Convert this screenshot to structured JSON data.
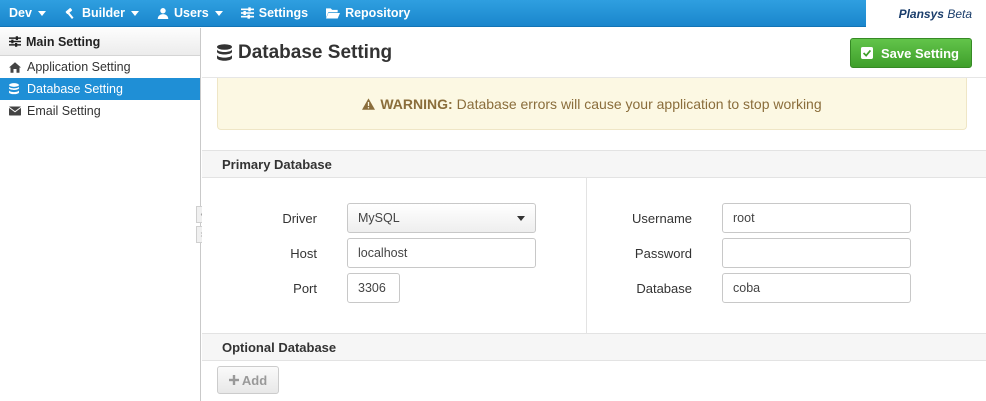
{
  "nav": {
    "items": [
      {
        "label": "Dev",
        "icon": "none",
        "has_caret": true
      },
      {
        "label": "Builder",
        "icon": "gavel-icon",
        "has_caret": true
      },
      {
        "label": "Users",
        "icon": "user-icon",
        "has_caret": true
      },
      {
        "label": "Settings",
        "icon": "sliders-icon",
        "has_caret": false
      },
      {
        "label": "Repository",
        "icon": "folder-open-icon",
        "has_caret": false
      }
    ],
    "brand_name": "Plansys",
    "brand_suffix": "Beta"
  },
  "sidebar": {
    "header": "Main Setting",
    "items": [
      {
        "label": "Application Setting",
        "icon": "home-icon",
        "active": false
      },
      {
        "label": "Database Setting",
        "icon": "database-icon",
        "active": true
      },
      {
        "label": "Email Setting",
        "icon": "envelope-icon",
        "active": false
      }
    ]
  },
  "main": {
    "title": "Database Setting",
    "save_label": "Save Setting",
    "warning_strong": "WARNING:",
    "warning_text": "Database errors will cause your application to stop working",
    "primary_section": "Primary Database",
    "optional_section": "Optional Database",
    "add_label": "Add",
    "fields": {
      "driver": {
        "label": "Driver",
        "value": "MySQL"
      },
      "host": {
        "label": "Host",
        "value": "localhost"
      },
      "port": {
        "label": "Port",
        "value": "3306"
      },
      "username": {
        "label": "Username",
        "value": "root"
      },
      "password": {
        "label": "Password",
        "value": ""
      },
      "database": {
        "label": "Database",
        "value": "coba"
      }
    }
  },
  "colors": {
    "nav_bg": "#1a86cc",
    "active_item": "#1f8fd6",
    "save_button": "#3f9f2b",
    "warning_bg": "#fcf8e3",
    "warning_text": "#8a6d3b"
  }
}
